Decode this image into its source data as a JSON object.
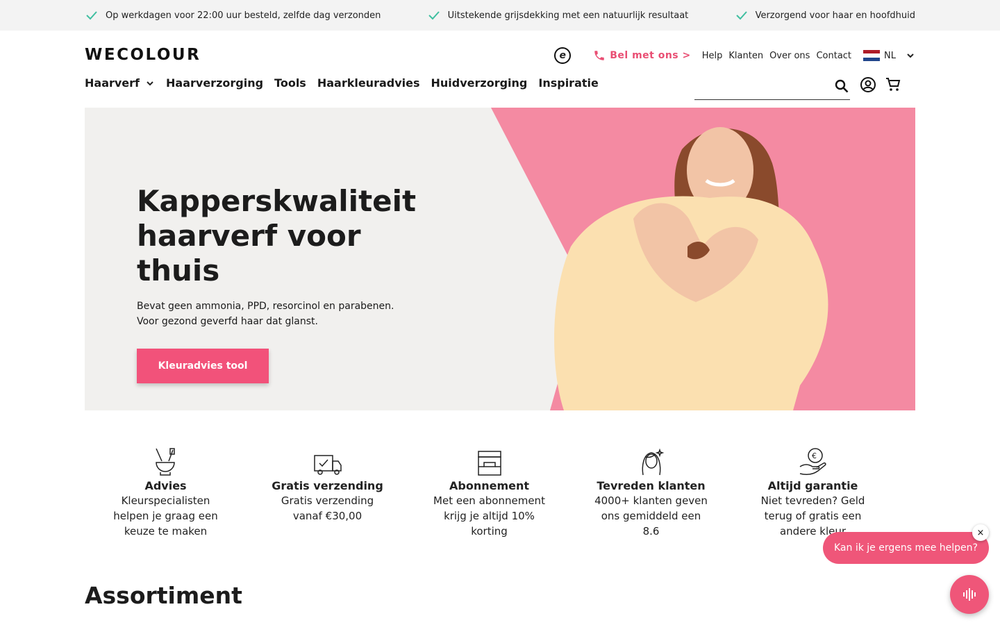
{
  "topbar": {
    "usps": [
      "Op werkdagen voor 22:00 uur besteld, zelfde dag verzonden",
      "Uitstekende grijsdekking met een natuurlijk resultaat",
      "Verzorgend voor haar en hoofdhuid"
    ],
    "check_color": "#3fbfa0"
  },
  "header": {
    "logo": "WECOLOUR",
    "trust_badge": "e",
    "call_label": "Bel met ons >",
    "links": [
      "Help",
      "Klanten",
      "Over ons",
      "Contact"
    ],
    "language": "NL"
  },
  "nav": {
    "items": [
      "Haarverf",
      "Haarverzorging",
      "Tools",
      "Haarkleuradvies",
      "Huidverzorging",
      "Inspiratie"
    ]
  },
  "search": {
    "placeholder": ""
  },
  "hero": {
    "title": "Kapperskwaliteit haarverf voor thuis",
    "text_line1": "Bevat geen ammonia, PPD, resorcinol en parabenen.",
    "text_line2": "Voor gezond geverfd haar dat glanst.",
    "cta": "Kleuradvies tool",
    "accent": "#f48aa2"
  },
  "features": [
    {
      "icon": "tools-icon",
      "title": "Advies",
      "text": "Kleurspecialisten helpen je graag een keuze te maken"
    },
    {
      "icon": "truck-icon",
      "title": "Gratis verzending",
      "text": "Gratis verzending vanaf €30,00"
    },
    {
      "icon": "box-icon",
      "title": "Abonnement",
      "text": "Met een abonnement krijg je altijd 10% korting"
    },
    {
      "icon": "customer-icon",
      "title": "Tevreden klanten",
      "text": "4000+ klanten geven ons gemiddeld een 8.6"
    },
    {
      "icon": "guarantee-icon",
      "title": "Altijd garantie",
      "text": "Niet tevreden? Geld terug of gratis een andere kleur"
    }
  ],
  "section_title": "Assortiment",
  "chat": {
    "message": "Kan ik je ergens mee helpen?",
    "close": "×",
    "color": "#ef5679"
  }
}
